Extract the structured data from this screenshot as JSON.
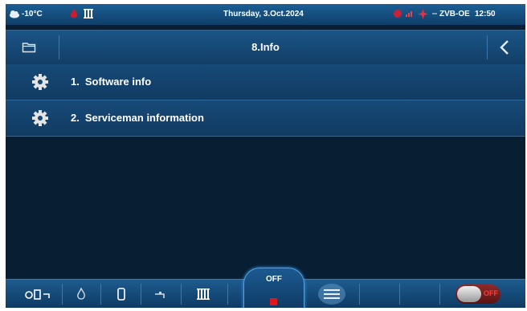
{
  "status_bar": {
    "temperature": "-10°C",
    "date": "Thursday, 3.Oct.2024",
    "device": "ZVB-OE",
    "time": "12:50",
    "icons": [
      "weather-cloud-icon",
      "flame-icon",
      "radiator-icon",
      "alarm-icon",
      "wifi-icon",
      "fan-icon",
      "signal-icon"
    ]
  },
  "title_bar": {
    "title": "8.Info",
    "left_icon": "folder-icon",
    "right_icon": "back-icon"
  },
  "menu": {
    "items": [
      {
        "number": "1.",
        "label": "Software info",
        "icon": "gear-icon"
      },
      {
        "number": "2.",
        "label": "Serviceman information",
        "icon": "gear-icon"
      }
    ]
  },
  "bottom_bar": {
    "mode_label": "OFF",
    "toggle_label": "OFF",
    "icons": [
      "system-mode-icon",
      "burner-icon",
      "boiler-icon",
      "tap-icon",
      "heater-icon",
      "menu-icon"
    ],
    "colors": {
      "off_indicator": "#e0161e",
      "accent": "#56a0dc"
    }
  }
}
